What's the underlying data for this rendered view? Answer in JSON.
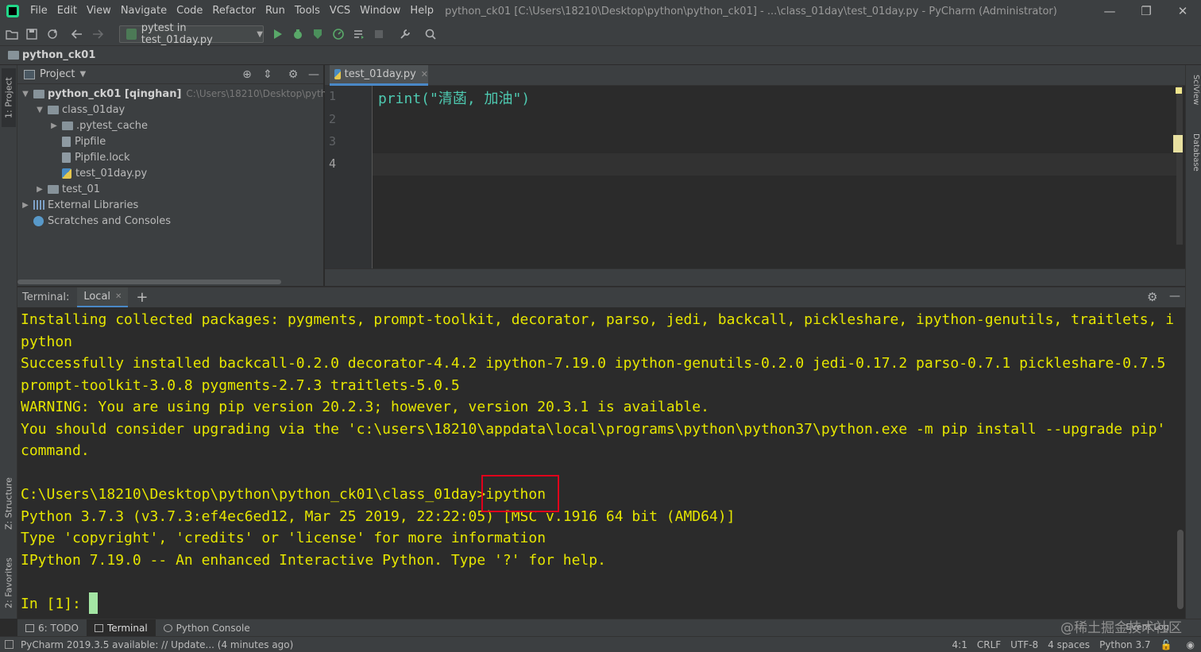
{
  "menu": {
    "items": [
      "File",
      "Edit",
      "View",
      "Navigate",
      "Code",
      "Refactor",
      "Run",
      "Tools",
      "VCS",
      "Window",
      "Help"
    ],
    "title": "python_ck01 [C:\\Users\\18210\\Desktop\\python\\python_ck01] - ...\\class_01day\\test_01day.py - PyCharm (Administrator)"
  },
  "toolbar": {
    "run_config": "pytest in test_01day.py"
  },
  "navbar": {
    "project": "python_ck01"
  },
  "left_strip": {
    "project_tab": "1: Project",
    "structure_tab": "Z: Structure",
    "favorites_tab": "2: Favorites"
  },
  "right_strip": {
    "sciview_tab": "SciView",
    "database_tab": "Database"
  },
  "project_panel": {
    "title": "Project",
    "tree": {
      "root_name": "python_ck01 [qinghan]",
      "root_path": "C:\\Users\\18210\\Desktop\\python\\py",
      "class_dir": "class_01day",
      "pytest_cache": ".pytest_cache",
      "pipfile": "Pipfile",
      "pipfile_lock": "Pipfile.lock",
      "test_file": "test_01day.py",
      "test_dir": "test_01",
      "ext_libs": "External Libraries",
      "scratches": "Scratches and Consoles"
    }
  },
  "editor": {
    "tab": "test_01day.py",
    "line_numbers": [
      "1",
      "2",
      "3",
      "4"
    ],
    "code": "print(\"清菡, 加油\")"
  },
  "terminal": {
    "label": "Terminal:",
    "tab": "Local",
    "lines": {
      "l1": "Installing collected packages: pygments, prompt-toolkit, decorator, parso, jedi, backcall, pickleshare, ipython-genutils, traitlets, i",
      "l2": "python",
      "l3": "Successfully installed backcall-0.2.0 decorator-4.4.2 ipython-7.19.0 ipython-genutils-0.2.0 jedi-0.17.2 parso-0.7.1 pickleshare-0.7.5",
      "l4": "prompt-toolkit-3.0.8 pygments-2.7.3 traitlets-5.0.5",
      "l5": "WARNING: You are using pip version 20.2.3; however, version 20.3.1 is available.",
      "l6": "You should consider upgrading via the 'c:\\users\\18210\\appdata\\local\\programs\\python\\python37\\python.exe -m pip install --upgrade pip'",
      "l7": "command.",
      "l8_path": "C:\\Users\\18210\\Desktop\\python\\python_ck01\\class_01day>",
      "l8_cmd": "ipython",
      "l9": "Python 3.7.3 (v3.7.3:ef4ec6ed12, Mar 25 2019, 22:22:05) [MSC v.1916 64 bit (AMD64)]",
      "l10": "Type 'copyright', 'credits' or 'license' for more information",
      "l11": "IPython 7.19.0 -- An enhanced Interactive Python. Type '?' for help.",
      "l12_prompt_in": "In [",
      "l12_num": "1",
      "l12_rest": "]: "
    }
  },
  "bottom_tabs": {
    "todo": "6: TODO",
    "terminal": "Terminal",
    "python_console": "Python Console",
    "event_log": "Event Log",
    "watermark": "@稀土掘金技术社区"
  },
  "status": {
    "message": "PyCharm 2019.3.5 available: // Update... (4 minutes ago)",
    "position": "4:1",
    "line_sep": "CRLF",
    "encoding": "UTF-8",
    "indent": "4 spaces",
    "interpreter": "Python 3.7"
  },
  "colors": {
    "accent": "#4a88c7",
    "highlight_box": "#e0001b",
    "terminal_yellow": "#e6e600",
    "terminal_green": "#3fce3f",
    "code_green": "#4ec9b0"
  }
}
